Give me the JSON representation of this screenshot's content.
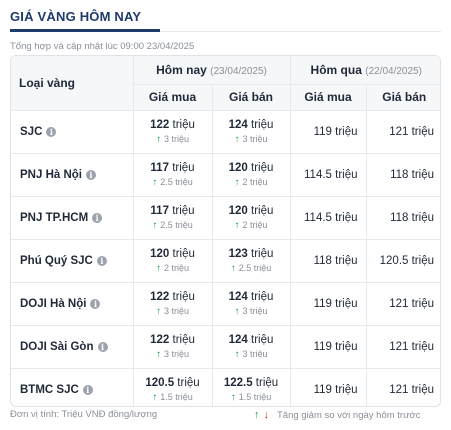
{
  "header": {
    "title": "GIÁ VÀNG HÔM NAY",
    "updated": "Tổng hợp và cập nhật lúc 09:00 23/04/2025"
  },
  "table": {
    "col_type": "Loại vàng",
    "today_label": "Hôm nay",
    "today_date": "(23/04/2025)",
    "yesterday_label": "Hôm qua",
    "yesterday_date": "(22/04/2025)",
    "buy_label": "Giá mua",
    "sell_label": "Giá bán",
    "info_glyph": "i",
    "up_glyph": "↑",
    "unit_suffix": "triệu",
    "rows": [
      {
        "name": "SJC",
        "buy_today": "122",
        "buy_change": "3 triệu",
        "sell_today": "124",
        "sell_change": "3 triệu",
        "buy_yest": "119 triệu",
        "sell_yest": "121 triệu"
      },
      {
        "name": "PNJ Hà Nội",
        "buy_today": "117",
        "buy_change": "2.5 triệu",
        "sell_today": "120",
        "sell_change": "2 triệu",
        "buy_yest": "114.5 triệu",
        "sell_yest": "118 triệu"
      },
      {
        "name": "PNJ TP.HCM",
        "buy_today": "117",
        "buy_change": "2.5 triệu",
        "sell_today": "120",
        "sell_change": "2 triệu",
        "buy_yest": "114.5 triệu",
        "sell_yest": "118 triệu"
      },
      {
        "name": "Phú Quý SJC",
        "buy_today": "120",
        "buy_change": "2 triệu",
        "sell_today": "123",
        "sell_change": "2.5 triệu",
        "buy_yest": "118 triệu",
        "sell_yest": "120.5 triệu"
      },
      {
        "name": "DOJI Hà Nội",
        "buy_today": "122",
        "buy_change": "3 triệu",
        "sell_today": "124",
        "sell_change": "3 triệu",
        "buy_yest": "119 triệu",
        "sell_yest": "121 triệu"
      },
      {
        "name": "DOJI Sài Gòn",
        "buy_today": "122",
        "buy_change": "3 triệu",
        "sell_today": "124",
        "sell_change": "3 triệu",
        "buy_yest": "119 triệu",
        "sell_yest": "121 triệu"
      },
      {
        "name": "BTMC SJC",
        "buy_today": "120.5",
        "buy_change": "1.5 triệu",
        "sell_today": "122.5",
        "sell_change": "1.5 triệu",
        "buy_yest": "119 triệu",
        "sell_yest": "121 triệu"
      }
    ]
  },
  "footer": {
    "unit": "Đơn vị tính: Triệu VNĐ đồng/lượng",
    "up_arrow": "↑",
    "down_arrow": "↓",
    "legend": "Tăng giảm so với ngày hôm trước"
  },
  "colors": {
    "title": "#1f3a6d",
    "up": "#16a34a",
    "down": "#dc2626",
    "muted": "#8a8f98"
  },
  "icons": [
    "info-icon",
    "arrow-up-icon",
    "arrow-down-icon"
  ]
}
